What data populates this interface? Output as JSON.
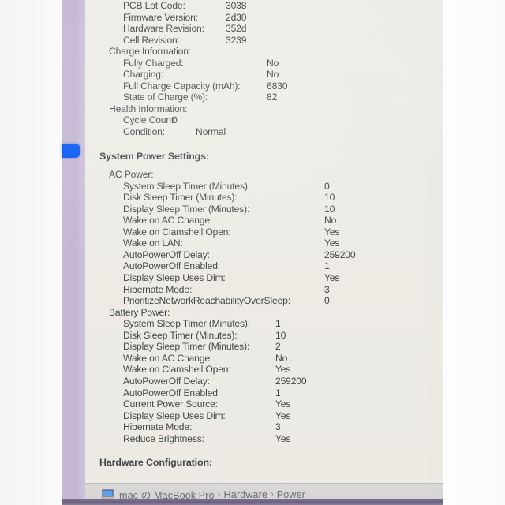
{
  "app": {
    "pane_background": "#eceae4",
    "sidebar_color": "#c7b9d4",
    "selection_color": "#0a5cf5"
  },
  "report": {
    "battery_information": [
      {
        "label": "PCB Lot Code:",
        "value": "3038"
      },
      {
        "label": "Firmware Version:",
        "value": "2d30"
      },
      {
        "label": "Hardware Revision:",
        "value": "352d"
      },
      {
        "label": "Cell Revision:",
        "value": "3239"
      }
    ],
    "charge_information_head": "Charge Information:",
    "charge_information": [
      {
        "label": "Fully Charged:",
        "value": "No"
      },
      {
        "label": "Charging:",
        "value": "No"
      },
      {
        "label": "Full Charge Capacity (mAh):",
        "value": "6830"
      },
      {
        "label": "State of Charge (%):",
        "value": "82"
      }
    ],
    "health_information_head": "Health Information:",
    "health_information": [
      {
        "label": "Cycle Count:",
        "value": "0"
      },
      {
        "label": "Condition:",
        "value": "Normal"
      }
    ],
    "system_power_settings_head": "System Power Settings:",
    "ac_power_head": "AC Power:",
    "ac_power": [
      {
        "label": "System Sleep Timer (Minutes):",
        "value": "0"
      },
      {
        "label": "Disk Sleep Timer (Minutes):",
        "value": "10"
      },
      {
        "label": "Display Sleep Timer (Minutes):",
        "value": "10"
      },
      {
        "label": "Wake on AC Change:",
        "value": "No"
      },
      {
        "label": "Wake on Clamshell Open:",
        "value": "Yes"
      },
      {
        "label": "Wake on LAN:",
        "value": "Yes"
      },
      {
        "label": "AutoPowerOff Delay:",
        "value": "259200"
      },
      {
        "label": "AutoPowerOff Enabled:",
        "value": "1"
      },
      {
        "label": "Display Sleep Uses Dim:",
        "value": "Yes"
      },
      {
        "label": "Hibernate Mode:",
        "value": "3"
      },
      {
        "label": "PrioritizeNetworkReachabilityOverSleep:",
        "value": "0"
      }
    ],
    "battery_power_head": "Battery Power:",
    "battery_power": [
      {
        "label": "System Sleep Timer (Minutes):",
        "value": "1"
      },
      {
        "label": "Disk Sleep Timer (Minutes):",
        "value": "10"
      },
      {
        "label": "Display Sleep Timer (Minutes):",
        "value": "2"
      },
      {
        "label": "Wake on AC Change:",
        "value": "No"
      },
      {
        "label": "Wake on Clamshell Open:",
        "value": "Yes"
      },
      {
        "label": "AutoPowerOff Delay:",
        "value": "259200"
      },
      {
        "label": "AutoPowerOff Enabled:",
        "value": "1"
      },
      {
        "label": "Current Power Source:",
        "value": "Yes"
      },
      {
        "label": "Display Sleep Uses Dim:",
        "value": "Yes"
      },
      {
        "label": "Hibernate Mode:",
        "value": "3"
      },
      {
        "label": "Reduce Brightness:",
        "value": "Yes"
      }
    ],
    "hardware_configuration_head": "Hardware Configuration:"
  },
  "statusbar": {
    "icon": "macbook-icon",
    "crumbs": [
      "mac の MacBook Pro",
      "Hardware",
      "Power"
    ],
    "separator": "›"
  }
}
